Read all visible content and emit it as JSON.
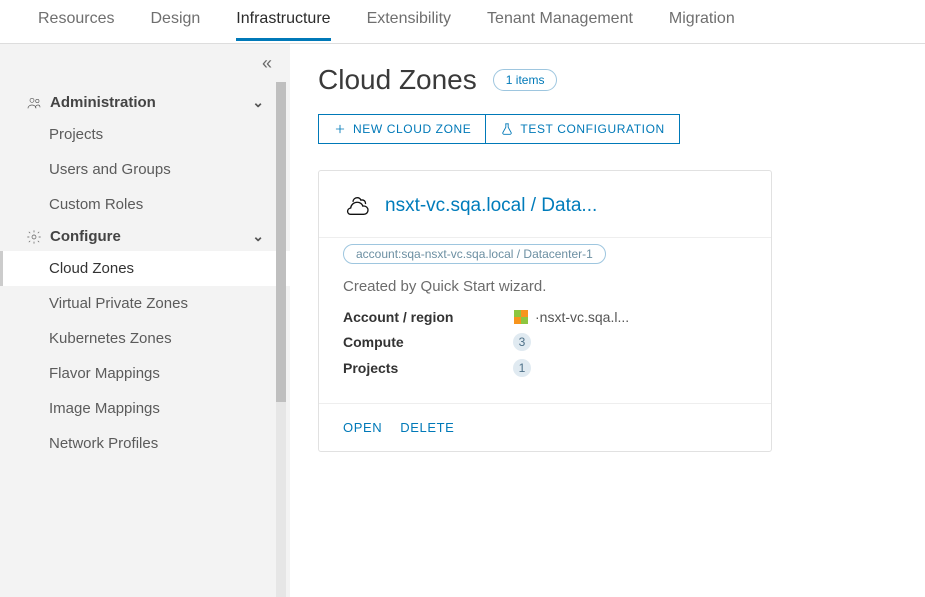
{
  "tabs": {
    "resources": "Resources",
    "design": "Design",
    "infrastructure": "Infrastructure",
    "extensibility": "Extensibility",
    "tenant_management": "Tenant Management",
    "migration": "Migration"
  },
  "sidebar": {
    "admin_header": "Administration",
    "admin_items": [
      "Projects",
      "Users and Groups",
      "Custom Roles"
    ],
    "configure_header": "Configure",
    "configure_items": [
      "Cloud Zones",
      "Virtual Private Zones",
      "Kubernetes Zones",
      "Flavor Mappings",
      "Image Mappings",
      "Network Profiles"
    ]
  },
  "page": {
    "title": "Cloud Zones",
    "count": "1 items",
    "new_btn": "NEW CLOUD ZONE",
    "test_btn": "TEST CONFIGURATION"
  },
  "card": {
    "title": "nsxt-vc.sqa.local / Data...",
    "tag": "account:sqa-nsxt-vc.sqa.local / Datacenter-1",
    "description": "Created by Quick Start wizard.",
    "account_label": "Account / region",
    "account_value": "·nsxt-vc.sqa.l...",
    "compute_label": "Compute",
    "compute_value": "3",
    "projects_label": "Projects",
    "projects_value": "1",
    "open": "OPEN",
    "delete": "DELETE"
  }
}
